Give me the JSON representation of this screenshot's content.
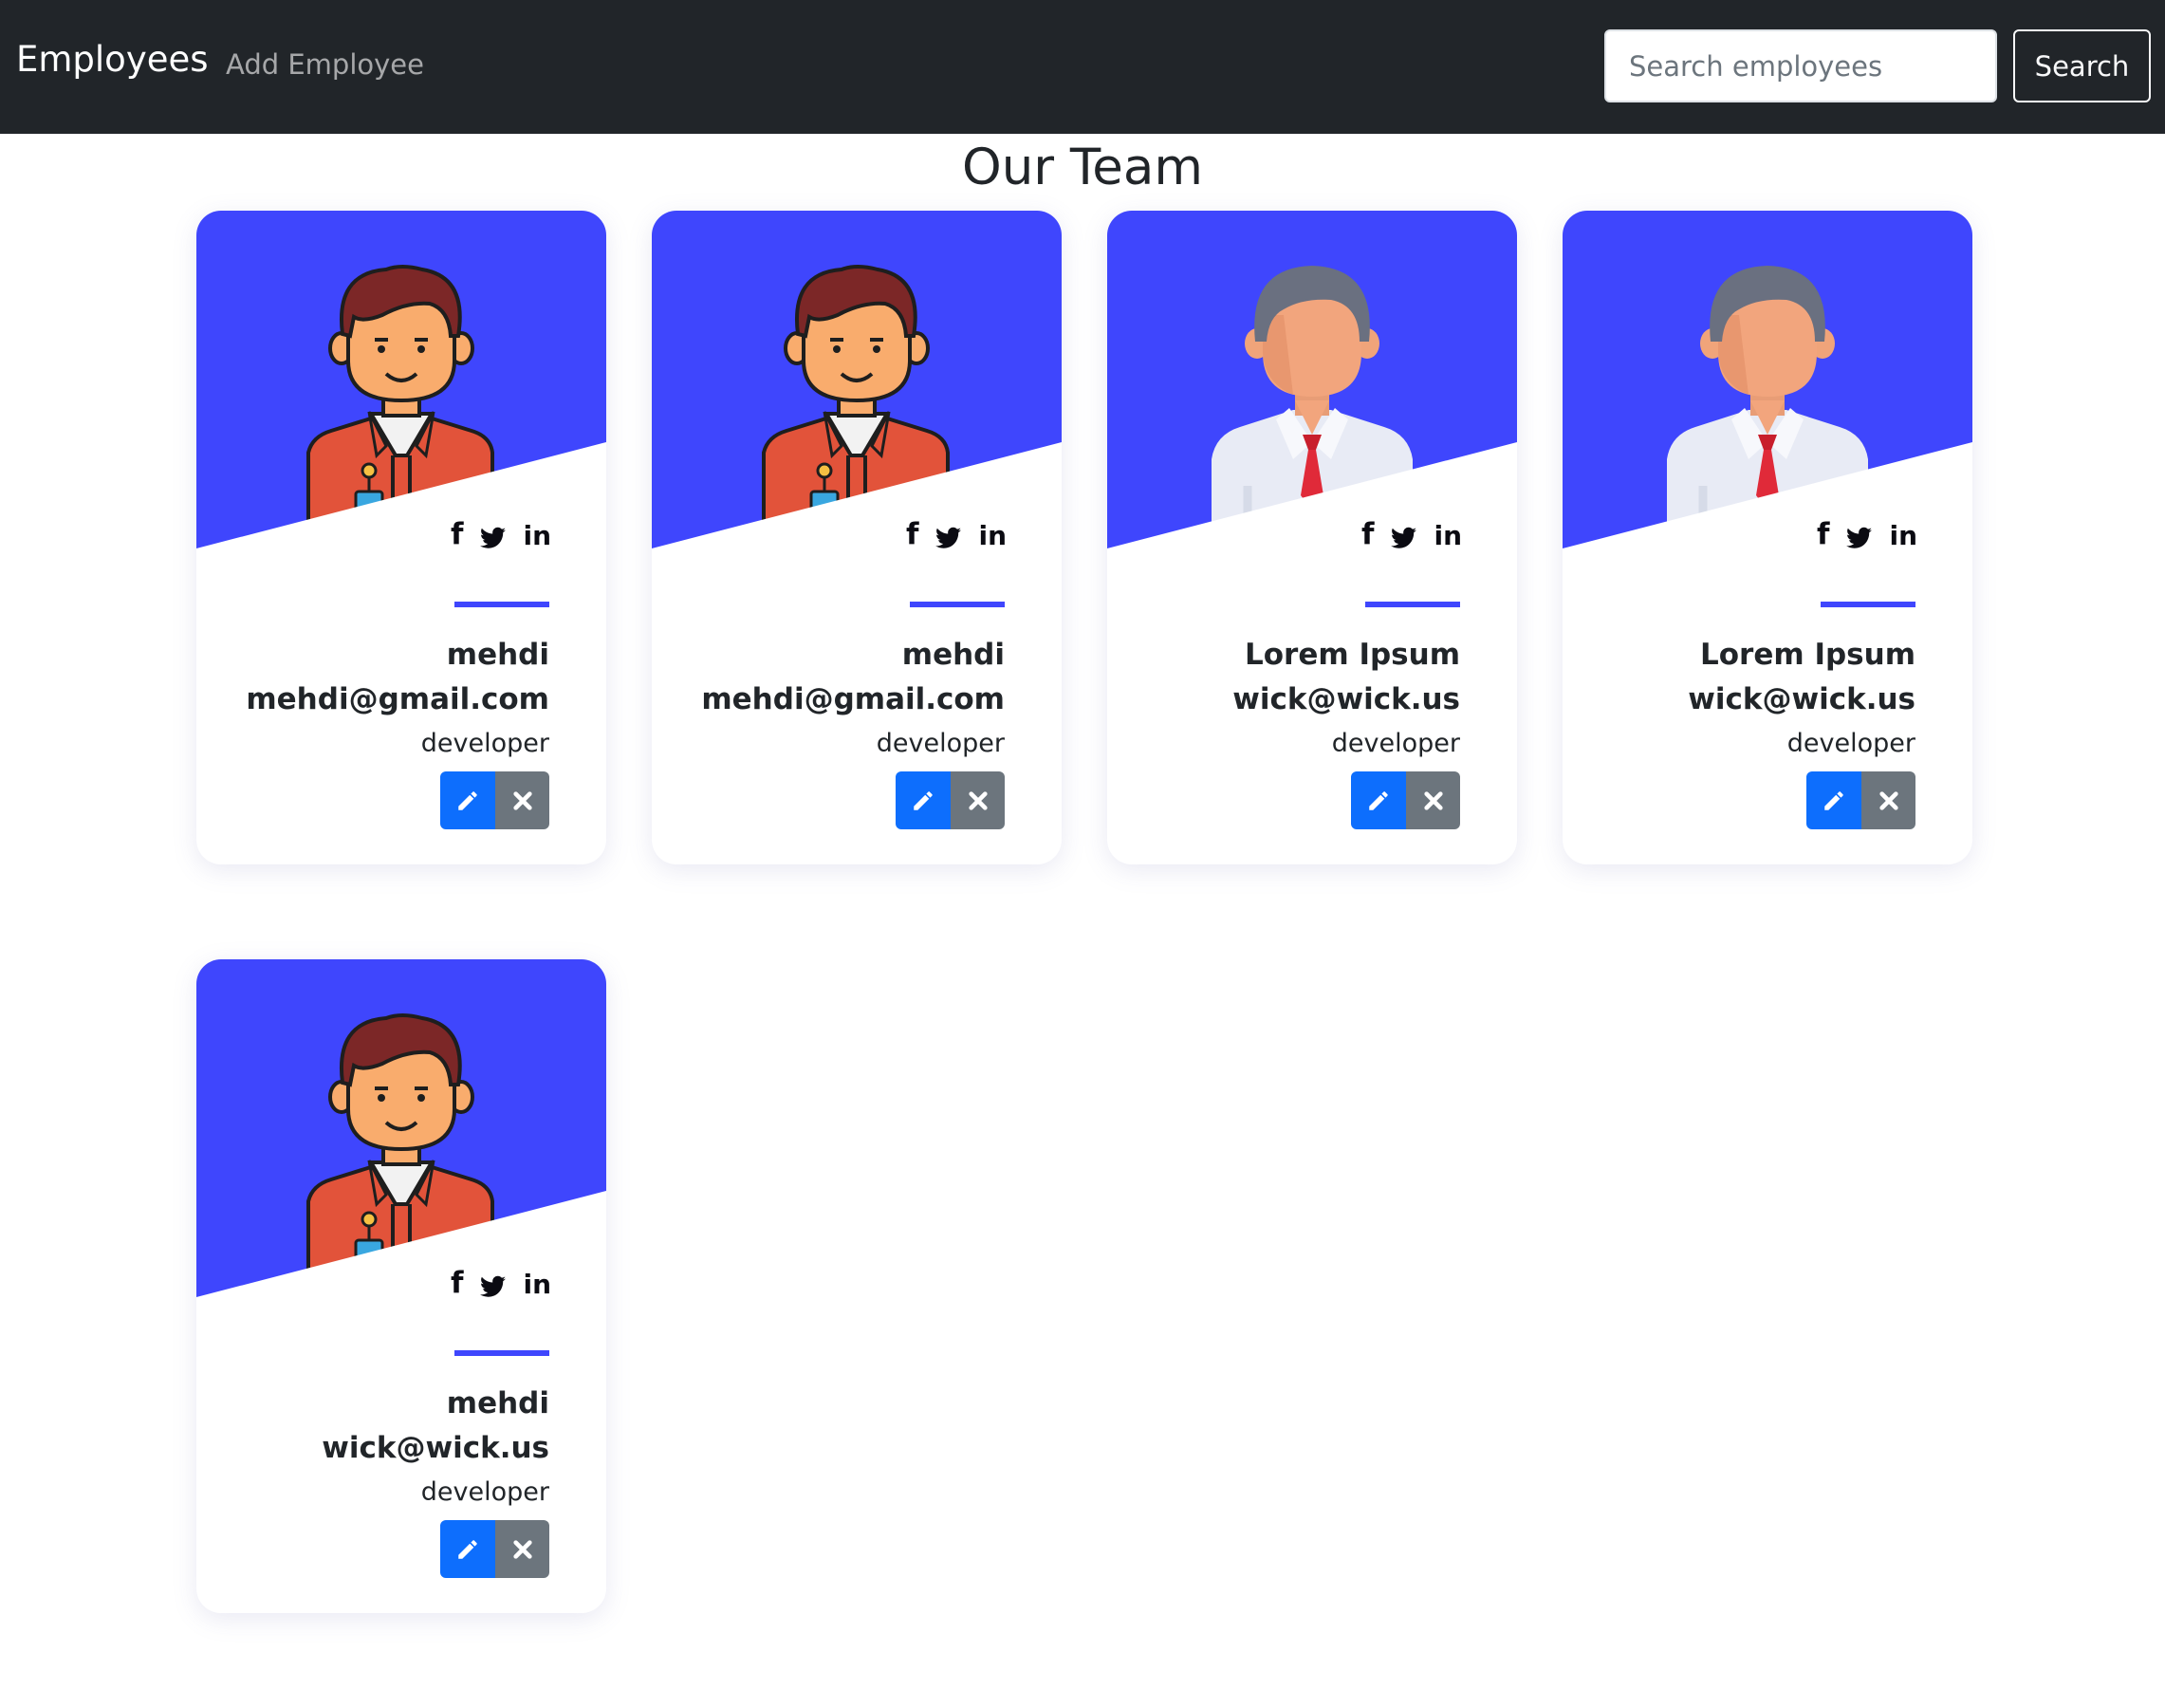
{
  "navbar": {
    "brand": "Employees",
    "add_link": "Add Employee",
    "search_placeholder": "Search employees",
    "search_button": "Search",
    "colors": {
      "background": "#212529",
      "text": "#ffffff"
    }
  },
  "page": {
    "title": "Our Team",
    "accent_color": "#3f46fd"
  },
  "cards": [
    {
      "name": "mehdi",
      "email": "mehdi@gmail.com",
      "role": "developer",
      "avatar": "casual-man-avatar",
      "social": [
        "facebook-icon",
        "twitter-icon",
        "linkedin-icon"
      ],
      "actions": [
        "edit-icon",
        "delete-icon"
      ]
    },
    {
      "name": "mehdi",
      "email": "mehdi@gmail.com",
      "role": "developer",
      "avatar": "casual-man-avatar",
      "social": [
        "facebook-icon",
        "twitter-icon",
        "linkedin-icon"
      ],
      "actions": [
        "edit-icon",
        "delete-icon"
      ]
    },
    {
      "name": "Lorem Ipsum",
      "email": "wick@wick.us",
      "role": "developer",
      "avatar": "business-man-avatar",
      "social": [
        "facebook-icon",
        "twitter-icon",
        "linkedin-icon"
      ],
      "actions": [
        "edit-icon",
        "delete-icon"
      ]
    },
    {
      "name": "Lorem Ipsum",
      "email": "wick@wick.us",
      "role": "developer",
      "avatar": "business-man-avatar",
      "social": [
        "facebook-icon",
        "twitter-icon",
        "linkedin-icon"
      ],
      "actions": [
        "edit-icon",
        "delete-icon"
      ]
    },
    {
      "name": "mehdi",
      "email": "wick@wick.us",
      "role": "developer",
      "avatar": "casual-man-avatar",
      "social": [
        "facebook-icon",
        "twitter-icon",
        "linkedin-icon"
      ],
      "actions": [
        "edit-icon",
        "delete-icon"
      ]
    }
  ],
  "icons": {
    "facebook_glyph": "f",
    "linkedin_glyph": "in"
  },
  "button_colors": {
    "edit": "#0d6efd",
    "delete": "#6c757d"
  }
}
